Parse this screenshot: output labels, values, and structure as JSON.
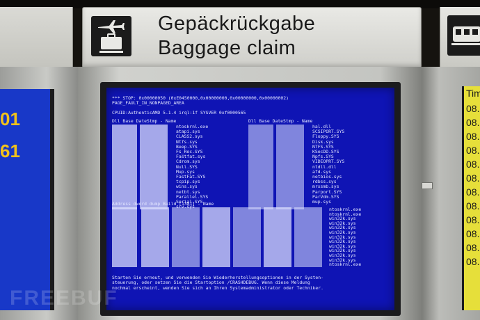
{
  "sign": {
    "line_de": "Gepäckrückgabe",
    "line_en": "Baggage claim",
    "icon": "airplane-baggage-icon"
  },
  "right_sign": {
    "icon": "train-icon"
  },
  "left_screen": {
    "values": [
      "01",
      "61"
    ],
    "text_color": "#f2c21a",
    "background": "#1838c8"
  },
  "right_screen": {
    "header": "Tim",
    "rows": [
      "08.",
      "08.",
      "08.",
      "08.",
      "08.",
      "08.",
      "08.",
      "08.",
      "08.",
      "08.",
      "08.",
      "08."
    ],
    "background": "#e6df3a"
  },
  "bsod": {
    "background": "#0f14b4",
    "stop_line": "*** STOP: 0x00000050 (0xE0450000,0x00000000,0x00000000,0x00000002)",
    "error_line": "PAGE_FAULT_IN_NONPAGED_AREA",
    "cpu_line": "CPUID:AuthenticAMD 5.1.4 irql:1f  SYSVER 0xf0000565",
    "driver_header_left": "Dll Base DateStmp - Name",
    "driver_header_right": "Dll Base DateStmp - Name",
    "drivers_left": [
      "ntoskrnl.exe",
      "atapi.sys",
      "CLASS2.sys",
      "Ntfs.sys",
      "Beep.SYS",
      "Fs_Rec.SYS",
      "Fastfat.sys",
      "Cdrom.sys",
      "Null.SYS",
      "Mup.sys",
      "FastFat.SYS",
      "tcpip.sys",
      "wins.sys",
      "netbt.sys",
      "Parallel.SYS",
      "Serial.SYS",
      "srv.sys"
    ],
    "drivers_right": [
      "hal.dll",
      "SCSIPORT.SYS",
      "Floppy.SYS",
      "Disk.sys",
      "NTFS.SYS",
      "KSecDD.SYS",
      "Npfs.SYS",
      "VIDEOPRT.SYS",
      "ntdll.dll",
      "afd.sys",
      "netbios.sys",
      "rdbss.sys",
      "mrxsmb.sys",
      "Parport.SYS",
      "ParVdm.SYS",
      "mup.sys"
    ],
    "stack_header": "Address  dword dump   Build [1381]                                    - Name",
    "stack_names": [
      "ntoskrnl.exe",
      "ntoskrnl.exe",
      "win32k.sys",
      "win32k.sys",
      "win32k.sys",
      "win32k.sys",
      "win32k.sys",
      "win32k.sys",
      "win32k.sys",
      "win32k.sys",
      "win32k.sys",
      "win32k.sys",
      "ntoskrnl.exe"
    ],
    "footer": [
      "Starten Sie erneut, und verwenden Sie Wiederherstellungsoptionen in der Systen-",
      "steuerung, oder setzen Sie die Startoption /CRASHDEBUG. Wenn diese Meldung",
      "nochmal erscheint, wenden Sie sich an Ihren Systemadministrator oder Techniker."
    ]
  },
  "watermark": "FREEBUF"
}
